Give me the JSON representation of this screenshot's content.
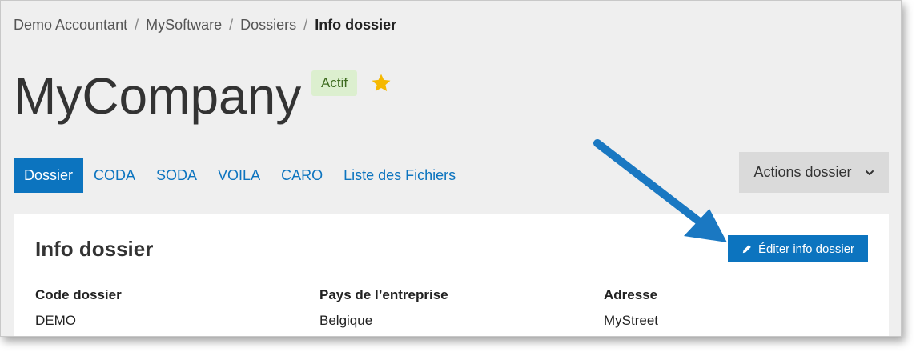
{
  "breadcrumb": {
    "items": [
      "Demo Accountant",
      "MySoftware",
      "Dossiers"
    ],
    "separator": "/",
    "current": "Info dossier"
  },
  "header": {
    "title": "MyCompany",
    "status_badge": "Actif",
    "favorite_icon": "star-icon"
  },
  "tabs": [
    {
      "label": "Dossier",
      "active": true
    },
    {
      "label": "CODA",
      "active": false
    },
    {
      "label": "SODA",
      "active": false
    },
    {
      "label": "VOILA",
      "active": false
    },
    {
      "label": "CARO",
      "active": false
    },
    {
      "label": "Liste des Fichiers",
      "active": false
    }
  ],
  "actions_menu": {
    "label": "Actions dossier",
    "icon": "chevron-down-icon"
  },
  "panel": {
    "title": "Info dossier",
    "edit_button": {
      "label": "Éditer info dossier",
      "icon": "pencil-icon"
    },
    "fields": [
      {
        "label": "Code dossier",
        "value": "DEMO"
      },
      {
        "label": "Pays de l’entreprise",
        "value": "Belgique"
      },
      {
        "label": "Adresse",
        "value": "MyStreet"
      }
    ]
  },
  "colors": {
    "primary": "#0c74bf",
    "badge_bg": "#dcefcf",
    "badge_text": "#3d6b1f",
    "star": "#f5b800",
    "annotation_arrow": "#1a78c2"
  }
}
